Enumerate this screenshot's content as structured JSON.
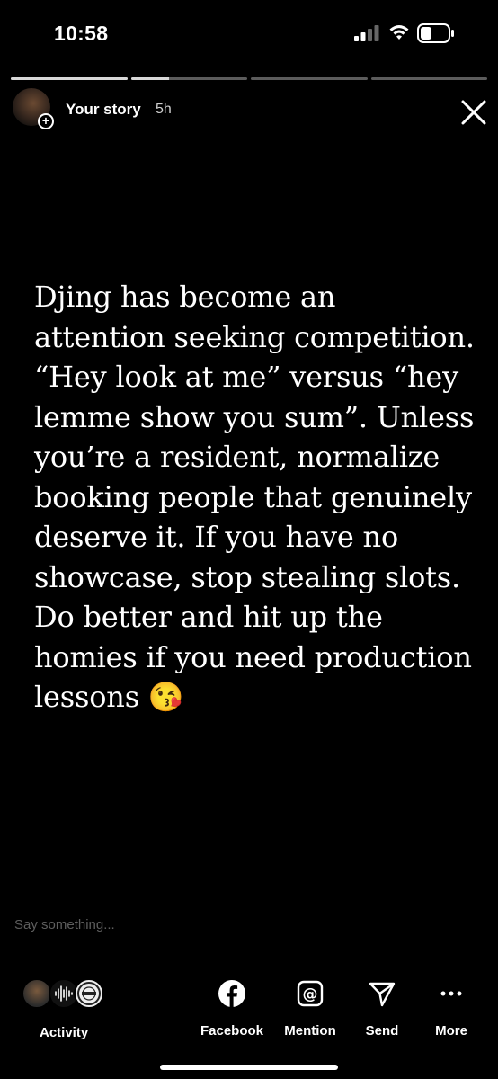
{
  "status_bar": {
    "time": "10:58"
  },
  "story": {
    "progress": [
      1,
      0.33,
      0,
      0
    ],
    "user": "Your story",
    "age": "5h",
    "text": "Djing has become an attention seeking competition. “Hey look at me” versus “hey lemme show you sum”. Unless you’re a resident, normalize booking people that genuinely deserve it. If you have no showcase, stop stealing slots. Do better and hit up the homies if you need production lessons 😘",
    "reply_placeholder": "Say something..."
  },
  "bottom_bar": {
    "activity_label": "Activity",
    "actions": [
      {
        "label": "Facebook",
        "icon": "facebook-icon"
      },
      {
        "label": "Mention",
        "icon": "mention-icon"
      },
      {
        "label": "Send",
        "icon": "send-icon"
      },
      {
        "label": "More",
        "icon": "more-icon"
      }
    ]
  }
}
